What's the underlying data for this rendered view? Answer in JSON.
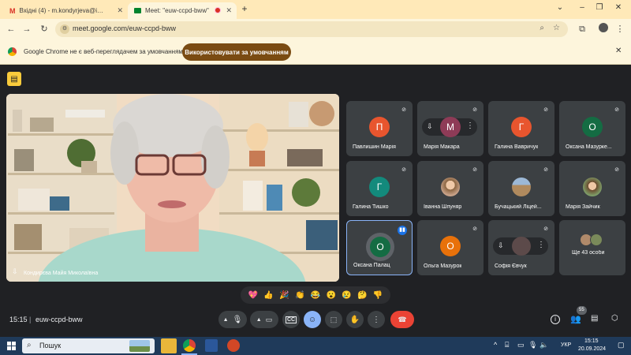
{
  "tabs": [
    {
      "title": "Вхідні (4) - m.kondyrjeva@ippo...",
      "close": "✕",
      "active": false
    },
    {
      "title": "Meet: \"euw-ccpd-bww\"",
      "close": "✕",
      "active": true
    }
  ],
  "tabstrip": {
    "new_tab": "+",
    "minimize": "–",
    "maximize": "❐",
    "close": "✕",
    "dropdown": "⌄"
  },
  "address": {
    "url": "meet.google.com/euw-ccpd-bww"
  },
  "infobar": {
    "text": "Google Chrome не є веб-переглядачем за умовчанням",
    "button": "Використовувати за умовчанням",
    "close": "✕"
  },
  "main_video": {
    "name": "Кондирєва Майя Миколаївна"
  },
  "participants": [
    {
      "name": "Павлишин Марія",
      "initial": "П",
      "color": "#e8552e"
    },
    {
      "name": "Марія Макара",
      "initial": "М",
      "color": "#8e3b57"
    },
    {
      "name": "Галина Вавричук",
      "initial": "Г",
      "color": "#e8552e"
    },
    {
      "name": "Оксана Мазурке...",
      "initial": "О",
      "color": "#146c43"
    },
    {
      "name": "Галина Тишко",
      "initial": "Г",
      "color": "#138a7c"
    },
    {
      "name": "Іванна Шпуняр",
      "initial": "",
      "color": "#c9a38a"
    },
    {
      "name": "Бучацький Ліцей...",
      "initial": "",
      "color": "#a08a70"
    },
    {
      "name": "Марія Зайчик",
      "initial": "",
      "color": "#9c7b5a"
    },
    {
      "name": "Оксана Палац",
      "initial": "О",
      "color": "#146c43"
    },
    {
      "name": "Ольга Мазурок",
      "initial": "О",
      "color": "#e8710a"
    },
    {
      "name": "Софія Євчук",
      "initial": "",
      "color": "#5c4a4a"
    },
    {
      "name": "Ще 43 особи",
      "initial": "",
      "color": "#3c4043"
    }
  ],
  "reactions": [
    "💖",
    "👍",
    "🎉",
    "👏",
    "😂",
    "😮",
    "😢",
    "🤔",
    "👎"
  ],
  "bottombar": {
    "time": "15:15",
    "separator": "|",
    "meeting_code": "euw-ccpd-bww",
    "participants_count": "55",
    "cc_label": "CC"
  },
  "taskbar": {
    "search_placeholder": "Пошук",
    "language": "УКР",
    "clock_time": "15:15",
    "clock_date": "20.09.2024"
  }
}
